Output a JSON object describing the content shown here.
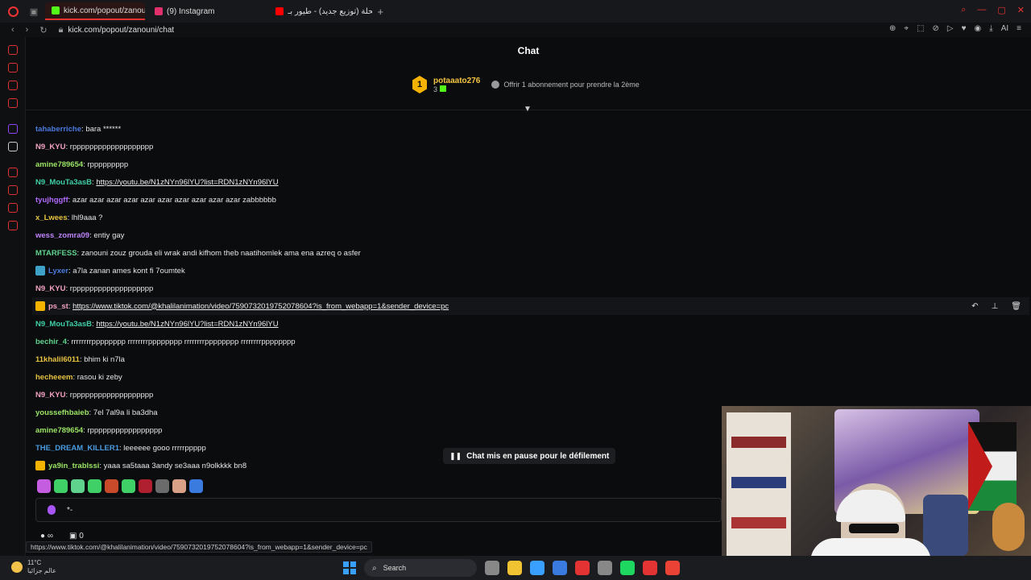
{
  "browser": {
    "tabs": [
      {
        "label": "kick.com/popout/zanouni/",
        "fav_color": "#53fc18",
        "active": true
      },
      {
        "label": "(9) Instagram",
        "fav_color": "#e1306c",
        "active": false
      },
      {
        "label": "النحلة (توزيع جديد) - طيور بـ...",
        "fav_color": "#ff0000",
        "active": false
      }
    ],
    "url": "kick.com/popout/zanouni/chat",
    "toolbar_ai": "AI"
  },
  "chat": {
    "title": "Chat",
    "pinned": {
      "rank": "1",
      "username": "potaaato276",
      "count": "3",
      "gift_text": "Offrir 1 abonnement pour prendre la 2ème"
    },
    "messages": [
      {
        "user": "tahaberriche",
        "color": "#4a7be0",
        "text": "bara ******",
        "link": false
      },
      {
        "user": "N9_KYU",
        "color": "#f2a1c2",
        "text": "rppppppppppppppppppp",
        "link": false
      },
      {
        "user": "amine789654",
        "color": "#9be564",
        "text": "rppppppppp",
        "link": false
      },
      {
        "user": "N9_MouTa3asB",
        "color": "#3fd0a8",
        "text": "https://youtu.be/N1zNYn96lYU?list=RDN1zNYn96lYU",
        "link": true
      },
      {
        "user": "tyujhggff",
        "color": "#b36bff",
        "text": "azar azar azar azar azar azar azar azar azar azar zabbbbbb",
        "link": false
      },
      {
        "user": "x_Lwees",
        "color": "#e8c341",
        "text": "lhl9aaa ?",
        "link": false
      },
      {
        "user": "wess_zomra09",
        "color": "#c084fc",
        "text": "entiy gay",
        "link": false
      },
      {
        "user": "MTARFESS",
        "color": "#5fd38d",
        "text": "zanouni zouz grouda eli wrak andi kifhom theb naatihomlek ama ena azreq o asfer",
        "link": false
      },
      {
        "user": "Lyxer",
        "color": "#4a7be0",
        "text": "a7la zanan ames kont fi 7oumtek",
        "link": false,
        "badge": "#3fa0c8"
      },
      {
        "user": "N9_KYU",
        "color": "#f2a1c2",
        "text": "rppppppppppppppppppp",
        "link": false
      },
      {
        "user": "ps_st",
        "color": "#f2a1c2",
        "text": "https://www.tiktok.com/@khalilanimation/video/7590732019752078604?is_from_webapp=1&sender_device=pc",
        "link": true,
        "badge": "#f5b301",
        "hover": true
      },
      {
        "user": "N9_MouTa3asB",
        "color": "#3fd0a8",
        "text": "https://youtu.be/N1zNYn96lYU?list=RDN1zNYn96lYU",
        "link": true
      },
      {
        "user": "bechir_4",
        "color": "#5fd38d",
        "text": "rrrrrrrrpppppppp rrrrrrrrpppppppp rrrrrrrrpppppppp rrrrrrrrpppppppp",
        "link": false
      },
      {
        "user": "11khalil6011",
        "color": "#e8c341",
        "text": "bhim ki n7la",
        "link": false
      },
      {
        "user": "hecheeem",
        "color": "#e8c341",
        "text": "rasou ki zeby",
        "link": false
      },
      {
        "user": "N9_KYU",
        "color": "#f2a1c2",
        "text": "rppppppppppppppppppp",
        "link": false
      },
      {
        "user": "youssefhbaieb",
        "color": "#9be564",
        "text": "7el 7al9a li ba3dha",
        "link": false
      },
      {
        "user": "amine789654",
        "color": "#9be564",
        "text": "rppppppppppppppppp",
        "link": false
      },
      {
        "user": "THE_DREAM_KILLER1",
        "color": "#4a9be0",
        "text": "leeeeee gooo rrrrrppppp",
        "link": false
      },
      {
        "user": "ya9in_trablssi",
        "color": "#9be564",
        "text": "yaaa sa5taaa 3andy se3aaa n9olkkkk bn8",
        "link": false,
        "badge": "#f5b301"
      }
    ],
    "pause_text": "Chat mis en pause pour le défilement",
    "input_value": "*-",
    "footer_count": "0",
    "emote_colors": [
      "#c45de0",
      "#3fd068",
      "#5fd38d",
      "#3fd068",
      "#c84a2a",
      "#3fd068",
      "#b01f2f",
      "#6b6b6b",
      "#d9a088",
      "#3a7be0"
    ]
  },
  "status_url": "https://www.tiktok.com/@khalilanimation/video/7590732019752078604?is_from_webapp=1&sender_device=pc",
  "taskbar": {
    "temp": "11°C",
    "weather_label": "عالم جزائيا",
    "search_label": "Search",
    "app_colors": [
      "#888888",
      "#f1c232",
      "#3aa0ff",
      "#3a7be0",
      "#e33333",
      "#888888",
      "#1ed760",
      "#e33333",
      "#ea4335"
    ]
  }
}
